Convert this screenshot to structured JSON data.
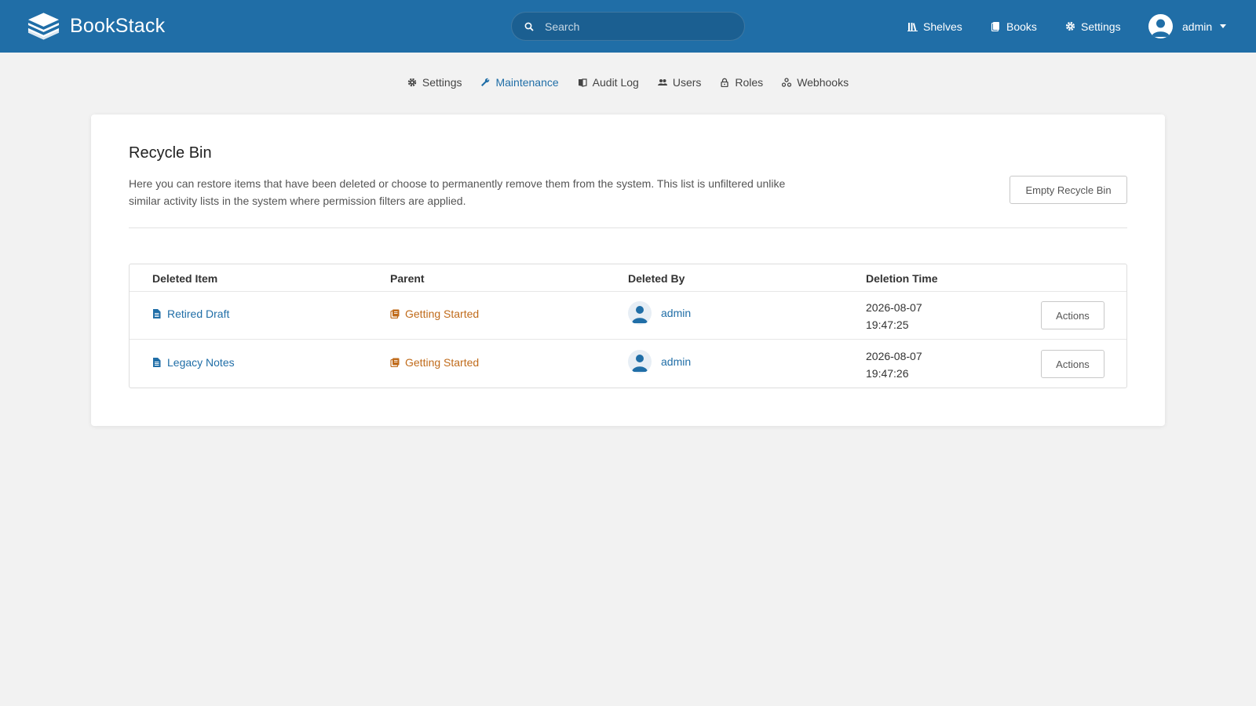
{
  "app": {
    "name": "BookStack",
    "logo_icon": "bookstack-logo-icon"
  },
  "search": {
    "placeholder": "Search",
    "value": ""
  },
  "header_nav": {
    "shelves": "Shelves",
    "books": "Books",
    "settings": "Settings"
  },
  "user": {
    "name": "admin"
  },
  "settings_nav": [
    {
      "label": "Settings",
      "icon": "gear-icon",
      "active": false
    },
    {
      "label": "Maintenance",
      "icon": "wrench-icon",
      "active": true
    },
    {
      "label": "Audit Log",
      "icon": "audit-log-icon",
      "active": false
    },
    {
      "label": "Users",
      "icon": "users-icon",
      "active": false
    },
    {
      "label": "Roles",
      "icon": "lock-icon",
      "active": false
    },
    {
      "label": "Webhooks",
      "icon": "webhooks-icon",
      "active": false
    }
  ],
  "recycle_bin": {
    "title": "Recycle Bin",
    "description": "Here you can restore items that have been deleted or choose to permanently remove them from the system. This list is unfiltered unlike similar activity lists in the system where permission filters are applied.",
    "empty_button": "Empty Recycle Bin"
  },
  "table": {
    "headers": {
      "item": "Deleted Item",
      "parent": "Parent",
      "deleted_by": "Deleted By",
      "time": "Deletion Time"
    },
    "rows": [
      {
        "item": "Retired Draft",
        "parent": "Getting Started",
        "deleted_by": "admin",
        "date": "2026-08-07",
        "time": "19:47:25",
        "action": "Actions"
      },
      {
        "item": "Legacy Notes",
        "parent": "Getting Started",
        "deleted_by": "admin",
        "date": "2026-08-07",
        "time": "19:47:26",
        "action": "Actions"
      }
    ]
  },
  "colors": {
    "header": "#206ea7",
    "link": "#206ea7",
    "book": "#c06b1b",
    "background": "#f2f2f2"
  }
}
